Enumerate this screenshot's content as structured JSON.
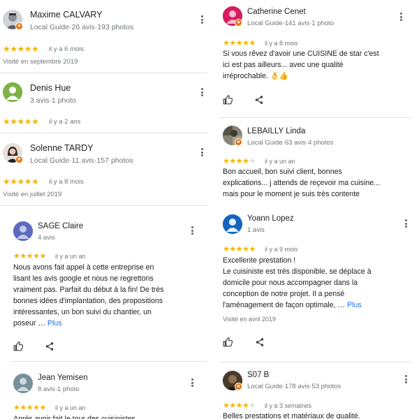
{
  "colors": {
    "star": "#f6b400",
    "star_empty": "#dadce0",
    "link": "#1a73e8",
    "muted": "#70757a",
    "guide_badge": "#e8710a"
  },
  "left": {
    "reviews": [
      {
        "name": "Maxime CALVARY",
        "meta": "Local Guide·26 avis·193 photos",
        "local_guide": true,
        "rating": 5,
        "when": "il y a 6 mois",
        "visited": "Visité en septembre 2019"
      },
      {
        "name": "Denis Hue",
        "meta": "3 avis·1 photo",
        "local_guide": false,
        "rating": 5,
        "when": "il y a 2 ans"
      },
      {
        "name": "Solenne TARDY",
        "meta": "Local Guide·11 avis·157 photos",
        "local_guide": true,
        "rating": 5,
        "when": "il y a 8 mois",
        "visited": "Visité en juillet 2019"
      },
      {
        "name": "SAGE Claire",
        "meta": "4 avis",
        "local_guide": false,
        "rating": 5,
        "when": "il y a un an",
        "text_lines": [
          "Nous avons fait appel à cette entreprise en",
          "lisant les avis google et nous ne regrettons",
          "vraiment pas. Parfait du début à la fin! De très",
          "bonnes idées d'implantation, des propositions",
          "intéressantes, un bon suivi du chantier, un",
          "poseur …"
        ],
        "more": "Plus"
      },
      {
        "name": "Jean Yemisen",
        "meta": "8 avis·1 photo",
        "local_guide": false,
        "rating": 5,
        "when": "il y a un an",
        "text_lines": [
          "Après avoir fait le tour des cuisinistes"
        ]
      }
    ]
  },
  "right": {
    "reviews": [
      {
        "name": "Catherine Cenet",
        "meta": "Local Guide·141 avis·1 photo",
        "local_guide": true,
        "rating": 5,
        "when": "il y a 8 mois",
        "text_lines": [
          "Si vous rêvez d'avoir une CUISINE de star c'est",
          "ici est pas ailleurs... avec une qualité",
          "irréprochable. 👌👍"
        ]
      },
      {
        "name": "LEBAILLY Linda",
        "meta": "Local Guide·63 avis·4 photos",
        "local_guide": true,
        "rating": 4,
        "when": "il y a un an",
        "text_lines": [
          "Bon accueil, bon suivi client, bonnes",
          "explications... j attends de reçevoir ma cuisine...",
          "mais pour le moment je suis très contente"
        ]
      },
      {
        "name": "Yoann Lopez",
        "meta": "1 avis",
        "local_guide": false,
        "rating": 5,
        "when": "il y a 9 mois",
        "text_lines": [
          "Excellente prestation !",
          "Le cuisiniste est très disponible, se déplace à",
          "domicile pour nous accompagner dans la",
          "conception de notre projet.  Il a pensé",
          "l'aménagement de façon optimale, …"
        ],
        "more": "Plus",
        "visited": "Visité en avril 2019"
      },
      {
        "name": "S07 B",
        "meta": "Local Guide·178 avis·53 photos",
        "local_guide": true,
        "rating": 4,
        "when": "il y a 3 semaines",
        "text_lines": [
          "Belles prestations et matériaux de qualité."
        ]
      }
    ]
  }
}
